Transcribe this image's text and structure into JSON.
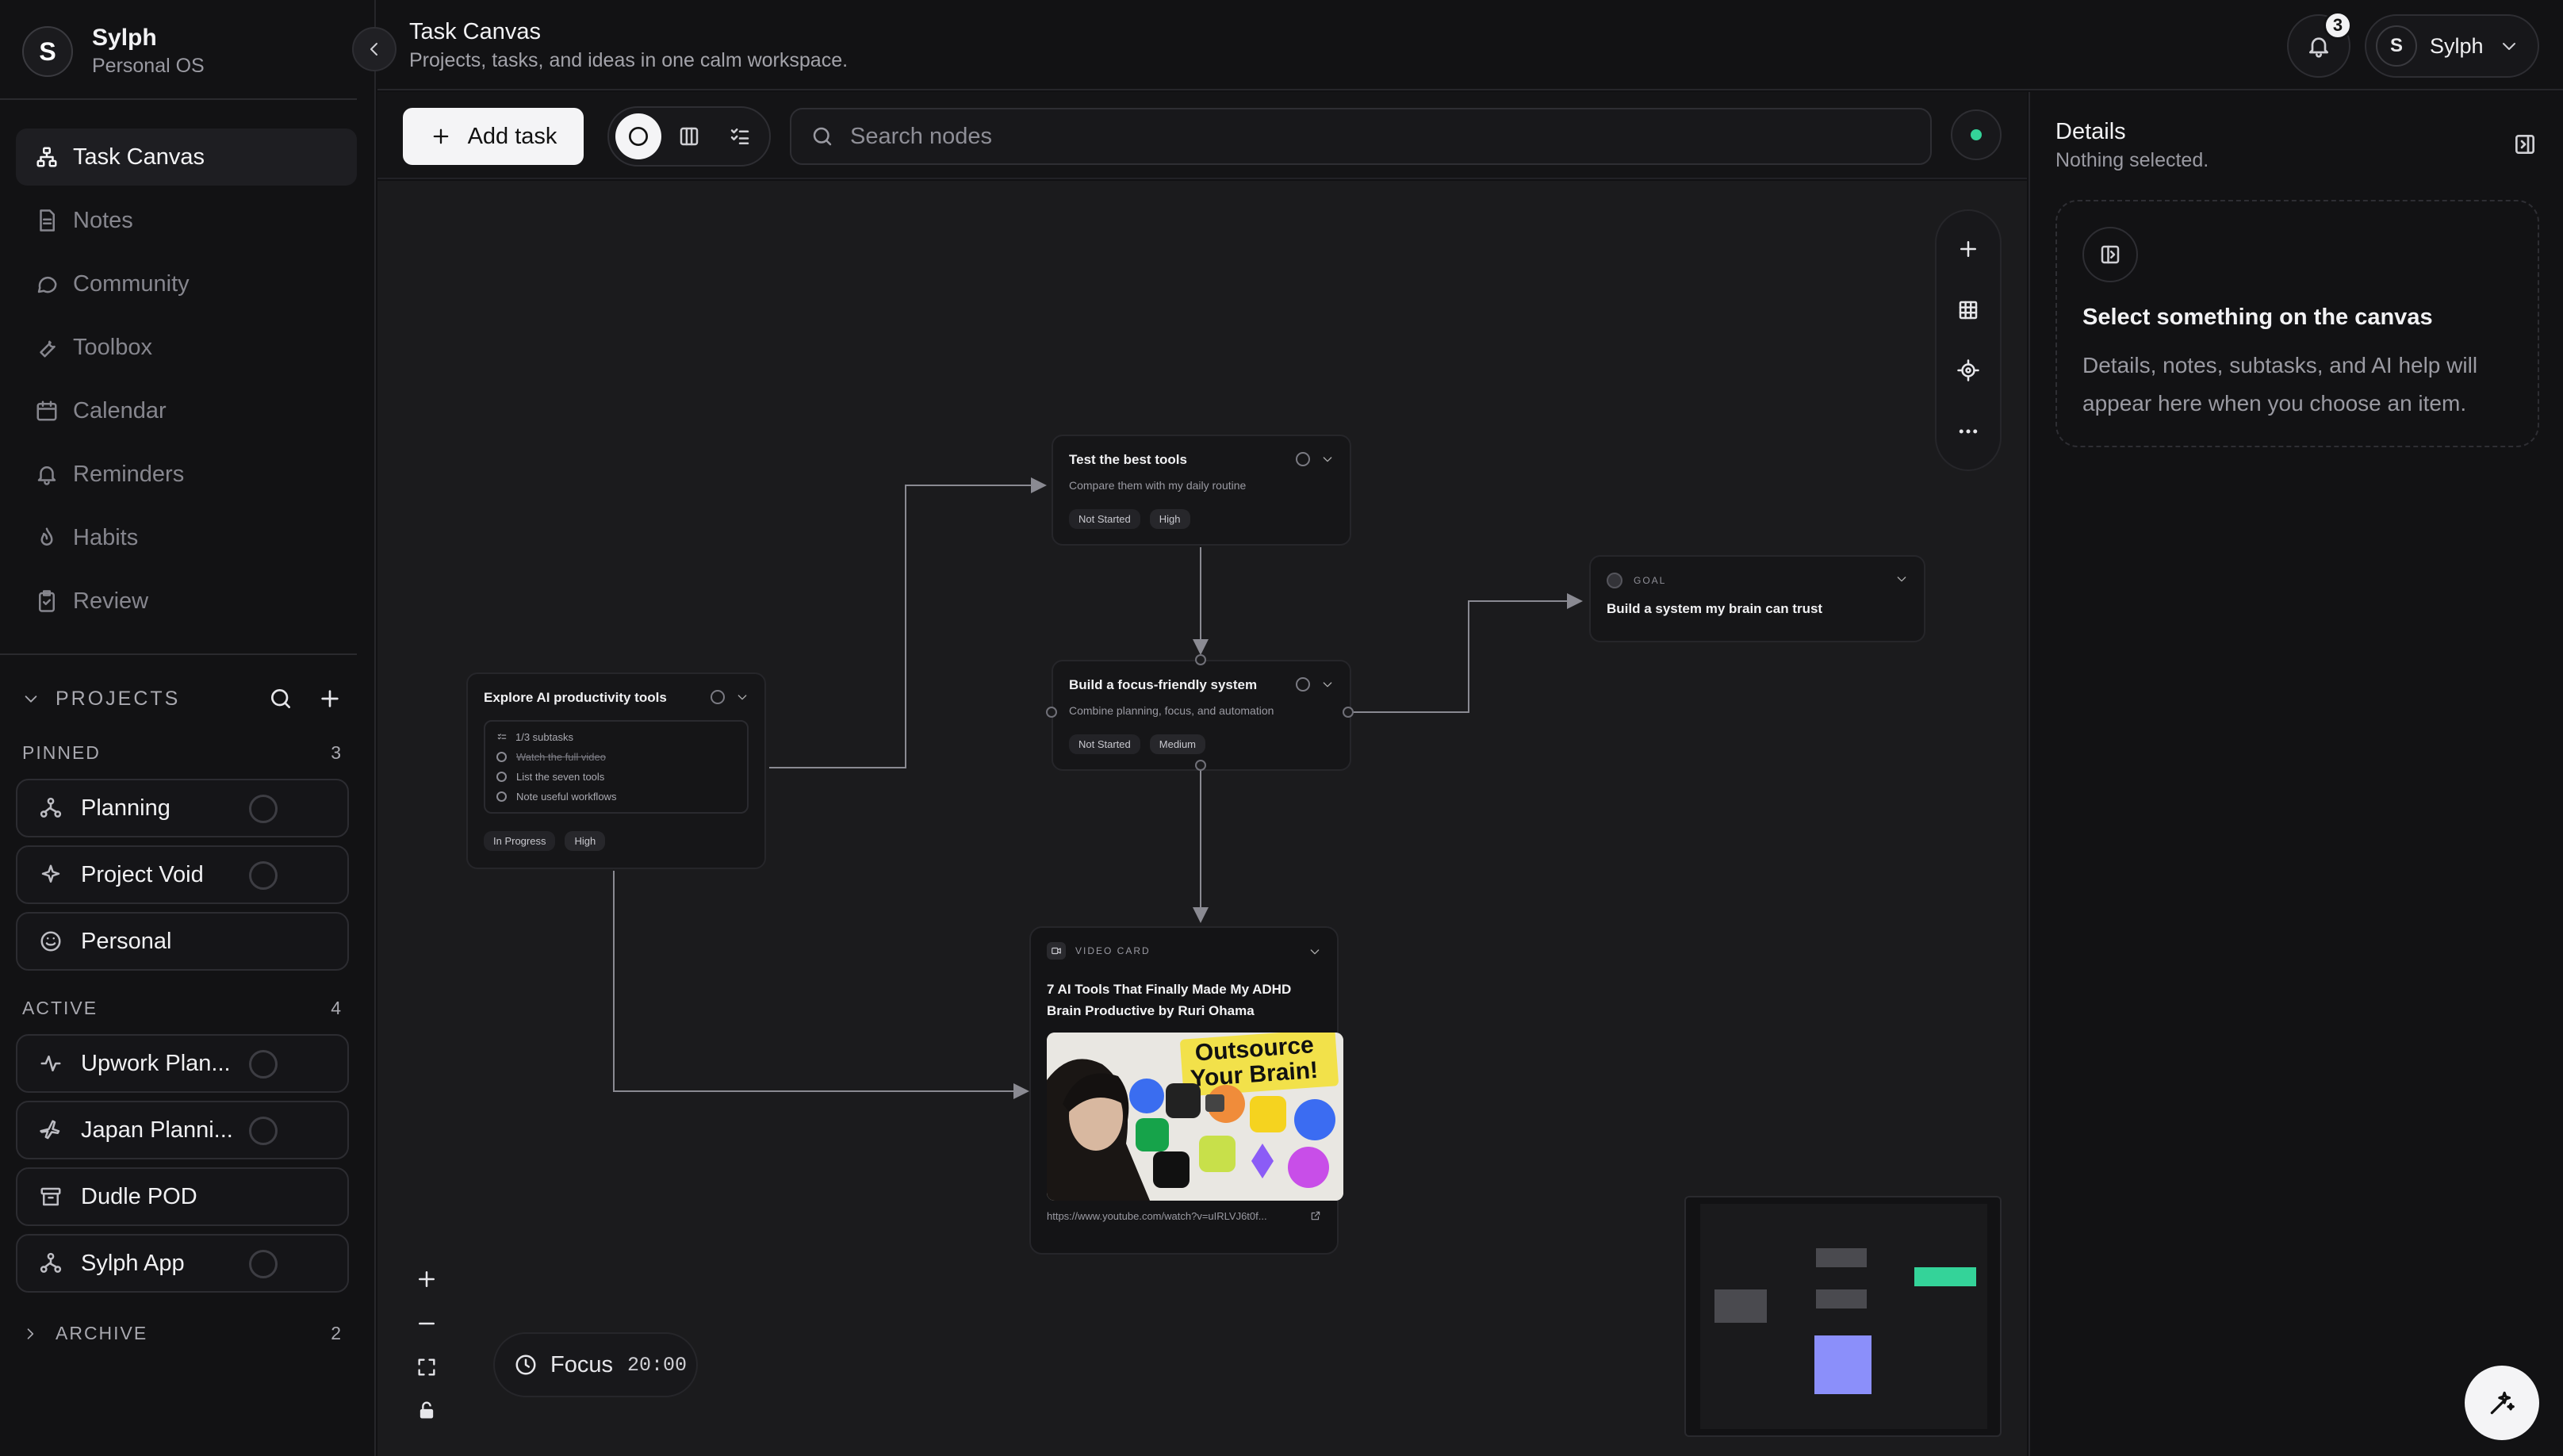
{
  "app": {
    "name": "Sylph",
    "subtitle": "Personal OS",
    "logo_letter": "S"
  },
  "sidebar": {
    "nav": [
      {
        "label": "Task Canvas",
        "icon": "network-icon",
        "active": true
      },
      {
        "label": "Notes",
        "icon": "document-icon"
      },
      {
        "label": "Community",
        "icon": "chat-icon"
      },
      {
        "label": "Toolbox",
        "icon": "wrench-icon"
      },
      {
        "label": "Calendar",
        "icon": "calendar-icon"
      },
      {
        "label": "Reminders",
        "icon": "bell-icon"
      },
      {
        "label": "Habits",
        "icon": "flame-icon"
      },
      {
        "label": "Review",
        "icon": "clipboard-icon"
      }
    ],
    "projects_label": "PROJECTS",
    "pinned": {
      "label": "PINNED",
      "count": "3",
      "items": [
        {
          "name": "Planning",
          "icon": "network-icon"
        },
        {
          "name": "Project Void",
          "icon": "sparkle-icon"
        },
        {
          "name": "Personal",
          "icon": "smile-icon"
        }
      ]
    },
    "active": {
      "label": "ACTIVE",
      "count": "4",
      "items": [
        {
          "name": "Upwork Plan...",
          "icon": "pulse-icon"
        },
        {
          "name": "Japan Planni...",
          "icon": "plane-icon"
        },
        {
          "name": "Dudle POD",
          "icon": "archive-icon"
        },
        {
          "name": "Sylph App",
          "icon": "network-icon"
        }
      ]
    },
    "archive": {
      "label": "ARCHIVE",
      "count": "2"
    }
  },
  "header": {
    "title": "Task Canvas",
    "subtitle": "Projects, tasks, and ideas in one calm workspace.",
    "notifications": "3",
    "user": "Sylph"
  },
  "toolbar": {
    "add_task": "Add task",
    "search_placeholder": "Search nodes"
  },
  "canvas": {
    "nodes": {
      "test_tools": {
        "title": "Test the best tools",
        "desc": "Compare them with my daily routine",
        "status": "Not Started",
        "priority": "High"
      },
      "focus_system": {
        "title": "Build a focus-friendly system",
        "desc": "Combine planning, focus, and automation",
        "status": "Not Started",
        "priority": "Medium"
      },
      "explore_ai": {
        "title": "Explore AI productivity tools",
        "subtasks_summary": "1/3 subtasks",
        "subtasks": [
          "Watch the full video",
          "List the seven tools",
          "Note useful workflows"
        ],
        "status": "In Progress",
        "priority": "High"
      },
      "goal": {
        "label": "GOAL",
        "title": "Build a system my brain can trust"
      },
      "video": {
        "label": "VIDEO CARD",
        "title": "7 AI Tools That Finally Made My ADHD Brain Productive by Ruri Ohama",
        "thumb_text_1": "Outsource",
        "thumb_text_2": "Your Brain!",
        "url": "https://www.youtube.com/watch?v=uIRLVJ6t0f..."
      }
    },
    "focus": {
      "label": "Focus",
      "time": "20:00"
    },
    "accent_colors": {
      "green": "#34d399",
      "indigo": "#8b8ffa"
    }
  },
  "details": {
    "title": "Details",
    "subtitle": "Nothing selected.",
    "empty_title": "Select something on the canvas",
    "empty_body": "Details, notes, subtasks, and AI help will appear here when you choose an item."
  }
}
